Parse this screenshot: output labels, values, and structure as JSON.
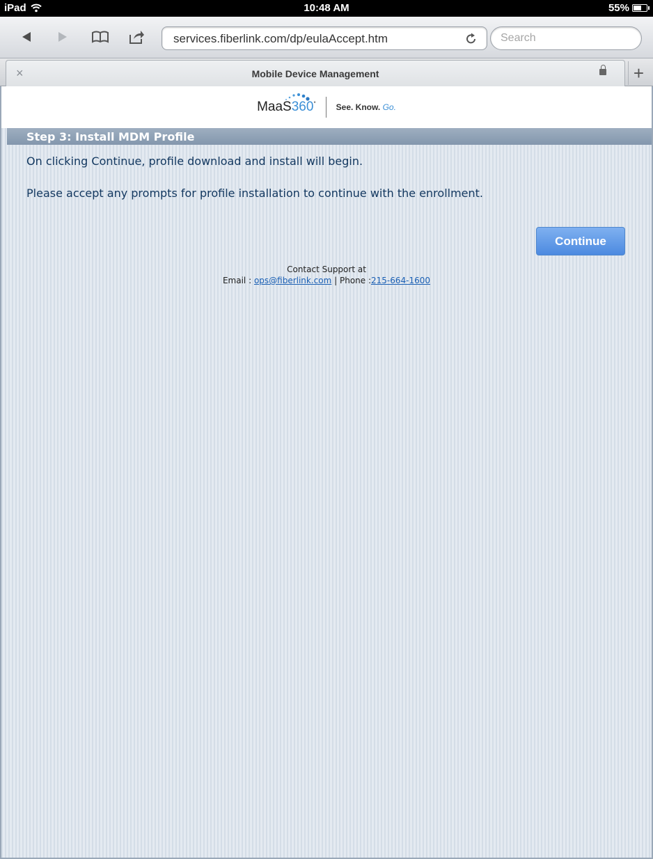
{
  "status_bar": {
    "device": "iPad",
    "time": "10:48 AM",
    "battery": "55%",
    "battery_level": 0.55
  },
  "toolbar": {
    "url": "services.fiberlink.com/dp/eulaAccept.htm",
    "search_placeholder": "Search"
  },
  "tab": {
    "close_glyph": "×",
    "title": "Mobile Device Management",
    "new_tab_glyph": "+"
  },
  "header": {
    "logo_text": "MaaS",
    "logo_num": "360",
    "logo_sup": "°",
    "tagline": "See. Know.",
    "tagline_go": "Go."
  },
  "content": {
    "step_title": "Step 3: Install MDM Profile",
    "line1": "On clicking Continue, profile download and install will begin.",
    "line2": "Please accept any prompts for profile installation to continue with the enrollment.",
    "continue_label": "Continue",
    "support": {
      "heading": "Contact Support at",
      "email_label": "Email : ",
      "email": "ops@fiberlink.com",
      "separator": " | Phone :",
      "phone": "215-664-1600"
    }
  },
  "colors": {
    "accent": "#3b8fd6",
    "text": "#12375f",
    "button": "#5b95e6"
  }
}
